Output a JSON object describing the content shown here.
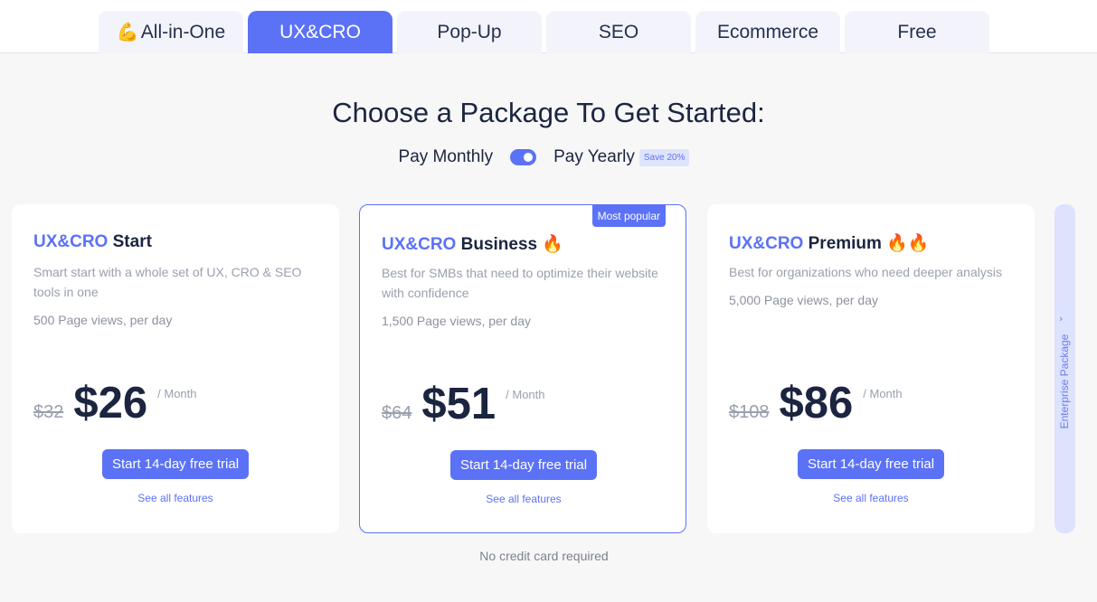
{
  "tabs": [
    {
      "emoji": "💪",
      "label": "All-in-One"
    },
    {
      "label": "UX&CRO"
    },
    {
      "label": "Pop-Up"
    },
    {
      "label": "SEO"
    },
    {
      "label": "Ecommerce"
    },
    {
      "label": "Free"
    }
  ],
  "heading": "Choose a Package To Get Started:",
  "billing": {
    "monthly_label": "Pay Monthly",
    "yearly_label": "Pay Yearly",
    "save_badge": "Save 20%"
  },
  "plans": [
    {
      "brand": "UX&CRO",
      "name": "Start",
      "fire": "",
      "description": "Smart start with a whole set of UX, CRO & SEO tools in one",
      "page_views": "500 Page views, per day",
      "old_price": "$32",
      "price": "$26",
      "period": "/ Month",
      "cta": "Start 14-day free trial",
      "features_link": "See all features"
    },
    {
      "brand": "UX&CRO",
      "name": "Business",
      "fire": "🔥",
      "badge": "Most popular",
      "description": "Best for SMBs that need to optimize their website with confidence",
      "page_views": "1,500 Page views, per day",
      "old_price": "$64",
      "price": "$51",
      "period": "/ Month",
      "cta": "Start 14-day free trial",
      "features_link": "See all features"
    },
    {
      "brand": "UX&CRO",
      "name": "Premium",
      "fire": "🔥🔥",
      "description": "Best for organizations who need deeper analysis",
      "page_views": "5,000 Page views, per day",
      "old_price": "$108",
      "price": "$86",
      "period": "/ Month",
      "cta": "Start 14-day free trial",
      "features_link": "See all features"
    }
  ],
  "enterprise": {
    "label": "Enterprise Package",
    "chevron": "›"
  },
  "footnote": "No credit card required",
  "colors": {
    "accent": "#5b72f6",
    "tab_bg": "#f3f4fb",
    "enterprise_bg": "#dde2fd"
  }
}
